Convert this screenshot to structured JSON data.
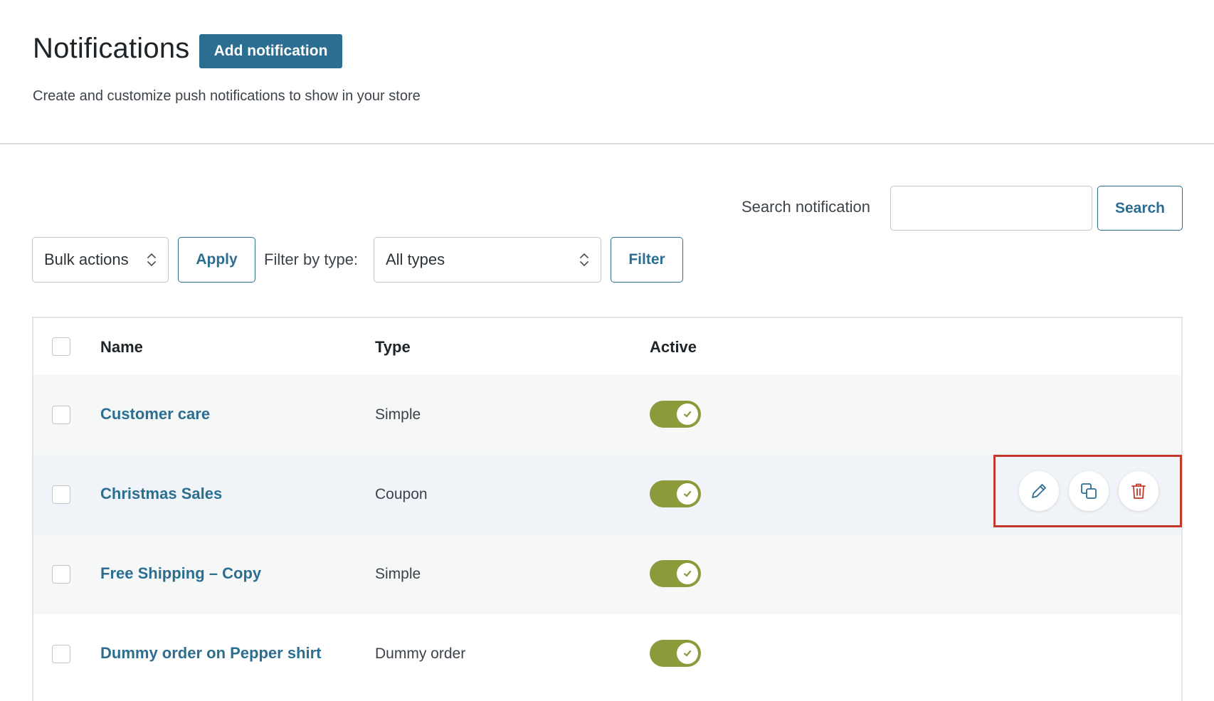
{
  "header": {
    "title": "Notifications",
    "add_button": "Add notification",
    "subtitle": "Create and customize push notifications to show in your store"
  },
  "search": {
    "label": "Search notification",
    "value": "",
    "button": "Search"
  },
  "toolbar": {
    "bulk_actions": "Bulk actions",
    "apply": "Apply",
    "filter_label": "Filter by type:",
    "type_value": "All types",
    "filter": "Filter"
  },
  "table": {
    "columns": [
      "Name",
      "Type",
      "Active"
    ],
    "rows": [
      {
        "name": "Customer care",
        "type": "Simple",
        "active": true
      },
      {
        "name": "Christmas Sales",
        "type": "Coupon",
        "active": true
      },
      {
        "name": "Free Shipping – Copy",
        "type": "Simple",
        "active": true
      },
      {
        "name": "Dummy order on Pepper shirt",
        "type": "Dummy order",
        "active": true
      }
    ]
  },
  "row_actions": [
    "pencil-icon",
    "duplicate-icon",
    "trash-icon"
  ],
  "colors": {
    "primary": "#2c6e91",
    "toggle_on": "#8c9a3b",
    "highlight_box": "#c4392b",
    "delete": "#c4392b"
  }
}
